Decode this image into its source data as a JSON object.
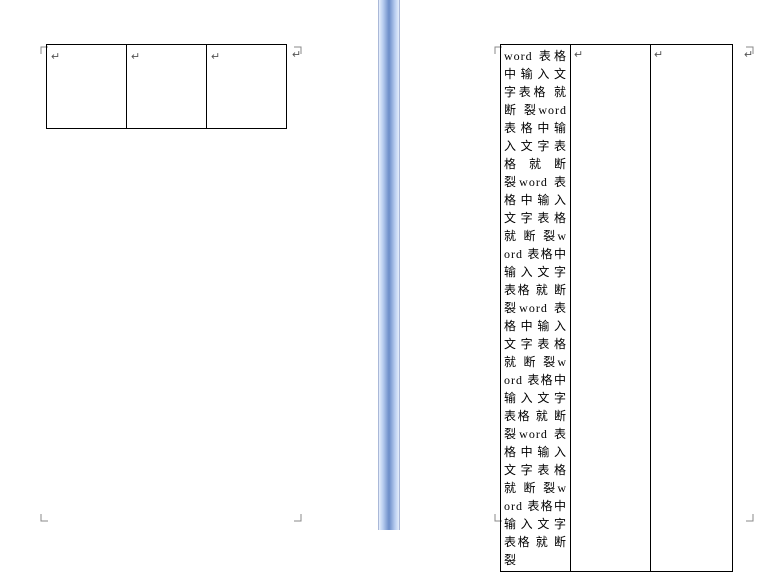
{
  "para_mark": "↵",
  "end_mark": "↵",
  "left_page": {
    "table": {
      "rows": 1,
      "cols": 3,
      "cells": [
        "",
        "",
        ""
      ]
    }
  },
  "right_page": {
    "table": {
      "cell_text_repeated": "word 表格中输入文字表格 就 断 裂",
      "repeat_count": 8,
      "cell2": "",
      "cell3": ""
    }
  }
}
